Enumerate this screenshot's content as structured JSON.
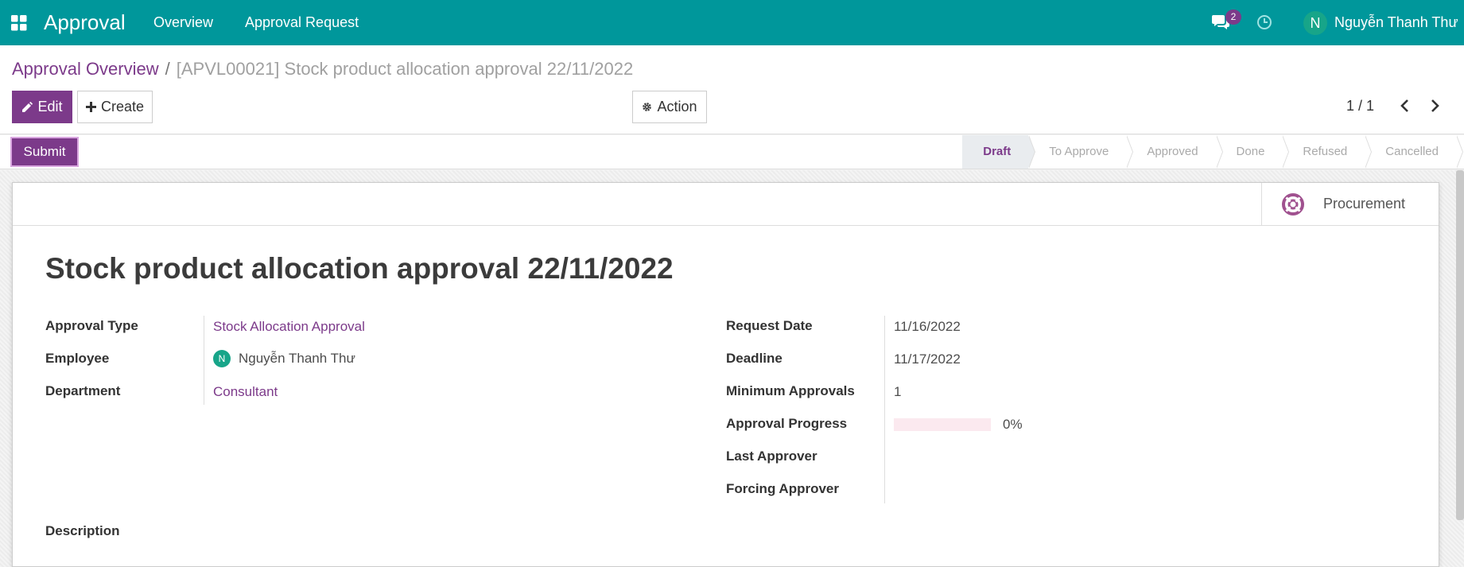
{
  "navbar": {
    "app_title": "Approval",
    "menu": [
      "Overview",
      "Approval Request"
    ],
    "chat_count": "2",
    "user_initial": "N",
    "user_name": "Nguyễn Thanh Thư"
  },
  "breadcrumb": {
    "parent": "Approval Overview",
    "separator": "/",
    "current": "[APVL00021] Stock product allocation approval 22/11/2022"
  },
  "toolbar": {
    "edit_label": "Edit",
    "create_label": "Create",
    "action_label": "Action",
    "pager": "1 / 1"
  },
  "statusbar": {
    "submit_label": "Submit",
    "stages": [
      "Draft",
      "To Approve",
      "Approved",
      "Done",
      "Refused",
      "Cancelled"
    ],
    "active_stage": "Draft"
  },
  "sheet": {
    "smart_button_label": "Procurement",
    "title": "Stock product allocation approval 22/11/2022",
    "left_fields": {
      "approval_type_label": "Approval Type",
      "approval_type_value": "Stock Allocation Approval",
      "employee_label": "Employee",
      "employee_initial": "N",
      "employee_value": "Nguyễn Thanh Thư",
      "department_label": "Department",
      "department_value": "Consultant"
    },
    "right_fields": {
      "request_date_label": "Request Date",
      "request_date_value": "11/16/2022",
      "deadline_label": "Deadline",
      "deadline_value": "11/17/2022",
      "min_approvals_label": "Minimum Approvals",
      "min_approvals_value": "1",
      "progress_label": "Approval Progress",
      "progress_value": "0%",
      "progress_fraction": 0,
      "last_approver_label": "Last Approver",
      "forcing_approver_label": "Forcing Approver"
    },
    "description_label": "Description"
  },
  "colors": {
    "navbar": "#00979b",
    "primary": "#7c3a8a",
    "avatar": "#17a589"
  }
}
